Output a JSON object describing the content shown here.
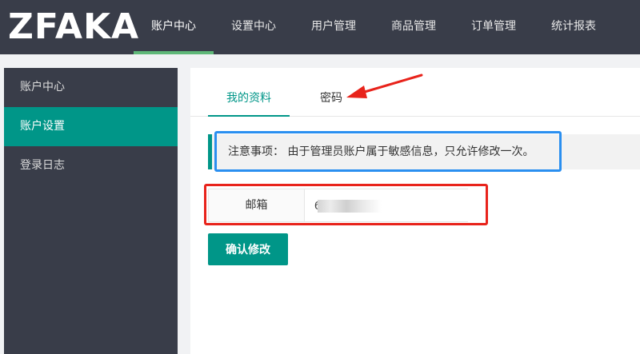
{
  "header": {
    "logo": "ZFAKA",
    "nav": [
      {
        "label": "账户中心",
        "active": true
      },
      {
        "label": "设置中心",
        "active": false
      },
      {
        "label": "用户管理",
        "active": false
      },
      {
        "label": "商品管理",
        "active": false
      },
      {
        "label": "订单管理",
        "active": false
      },
      {
        "label": "统计报表",
        "active": false
      }
    ]
  },
  "sidebar": {
    "items": [
      {
        "label": "账户中心",
        "active": false
      },
      {
        "label": "账户设置",
        "active": true
      },
      {
        "label": "登录日志",
        "active": false
      }
    ]
  },
  "main": {
    "tabs": [
      {
        "label": "我的资料",
        "active": true
      },
      {
        "label": "密码",
        "active": false
      }
    ],
    "notice": "注意事项： 由于管理员账户属于敏感信息，只允许修改一次。",
    "email_label": "邮箱",
    "email_value": "6@qq.com",
    "submit_label": "确认修改"
  },
  "colors": {
    "topbar": "#393d49",
    "accent": "#009688",
    "nav_indicator": "#5fb878",
    "annotation_blue": "#2a8ff0",
    "annotation_red": "#e8231b"
  }
}
